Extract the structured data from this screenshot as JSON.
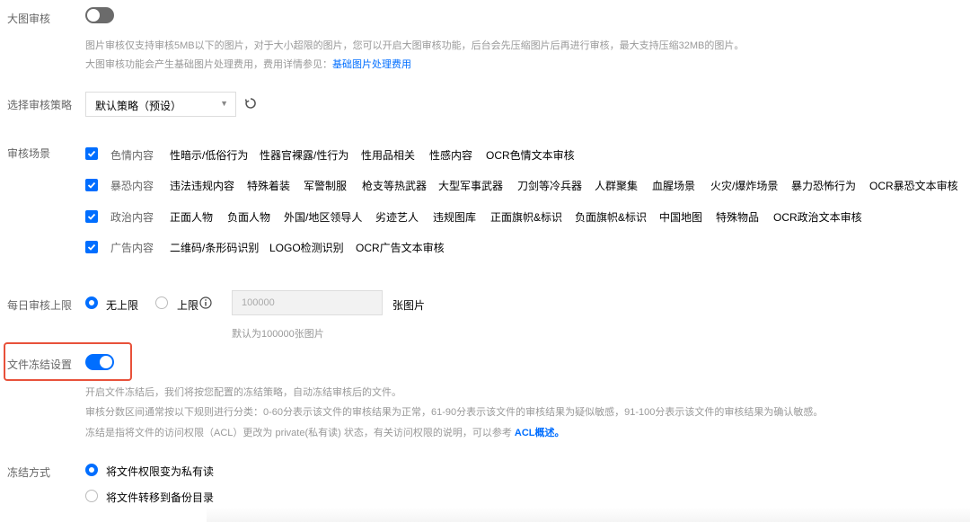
{
  "large_image": {
    "label": "大图审核",
    "enabled": false,
    "desc1": "图片审核仅支持审核5MB以下的图片，对于大小超限的图片，您可以开启大图审核功能，后台会先压缩图片后再进行审核，最大支持压缩32MB的图片。",
    "desc2_prefix": "大图审核功能会产生基础图片处理费用，费用详情参见：",
    "desc2_link": "基础图片处理费用"
  },
  "strategy": {
    "label": "选择审核策略",
    "selected": "默认策略（预设）",
    "refresh_icon": "refresh-icon"
  },
  "scenes": {
    "label": "审核场景",
    "rows": [
      {
        "category": "色情内容",
        "checked": true,
        "items": [
          "性暗示/低俗行为",
          "性器官裸露/性行为",
          "性用品相关",
          "性感内容",
          "OCR色情文本审核"
        ]
      },
      {
        "category": "暴恐内容",
        "checked": true,
        "items": [
          "违法违规内容",
          "特殊着装",
          "军警制服",
          "枪支等热武器",
          "大型军事武器",
          "刀剑等冷兵器",
          "人群聚集",
          "血腥场景",
          "火灾/爆炸场景",
          "暴力恐怖行为",
          "OCR暴恐文本审核"
        ]
      },
      {
        "category": "政治内容",
        "checked": true,
        "items": [
          "正面人物",
          "负面人物",
          "外国/地区领导人",
          "劣迹艺人",
          "违规图库",
          "正面旗帜&标识",
          "负面旗帜&标识",
          "中国地图",
          "特殊物品",
          "OCR政治文本审核"
        ]
      },
      {
        "category": "广告内容",
        "checked": true,
        "items": [
          "二维码/条形码识别",
          "LOGO检测识别",
          "OCR广告文本审核"
        ]
      }
    ]
  },
  "daily_limit": {
    "label": "每日审核上限",
    "option_unlimited": "无上限",
    "option_limit": "上限",
    "selected": "无上限",
    "info_icon": "info-icon",
    "input_placeholder": "100000",
    "unit": "张图片",
    "hint": "默认为100000张图片"
  },
  "freeze": {
    "label": "文件冻结设置",
    "enabled": true,
    "desc1": "开启文件冻结后，我们将按您配置的冻结策略，自动冻结审核后的文件。",
    "desc2": "审核分数区间通常按以下规则进行分类：0-60分表示该文件的审核结果为正常，61-90分表示该文件的审核结果为疑似敏感，91-100分表示该文件的审核结果为确认敏感。",
    "desc3_prefix": "冻结是指将文件的访问权限（ACL）更改为 private(私有读) 状态，有关访问权限的说明，可以参考 ",
    "desc3_link": "ACL概述。"
  },
  "freeze_method": {
    "label": "冻结方式",
    "options": [
      "将文件权限变为私有读",
      "将文件转移到备份目录"
    ],
    "selected": "将文件权限变为私有读"
  },
  "colors": {
    "accent": "#006eff",
    "highlight": "#e8513a"
  }
}
